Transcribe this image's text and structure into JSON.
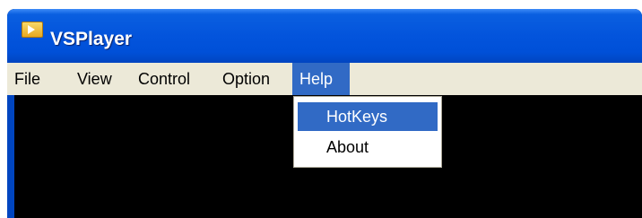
{
  "window": {
    "title": "VSPlayer",
    "icon": "player-app-icon"
  },
  "menubar": {
    "items": [
      {
        "label": "File"
      },
      {
        "label": "View"
      },
      {
        "label": "Control"
      },
      {
        "label": "Option"
      },
      {
        "label": "Help",
        "active": true
      }
    ]
  },
  "help_menu": {
    "items": [
      {
        "label": "HotKeys",
        "highlighted": true
      },
      {
        "label": "About"
      }
    ]
  },
  "colors": {
    "titlebar": "#0054e3",
    "menubar": "#ece9d8",
    "highlight": "#316ac5",
    "video_area": "#000000"
  }
}
